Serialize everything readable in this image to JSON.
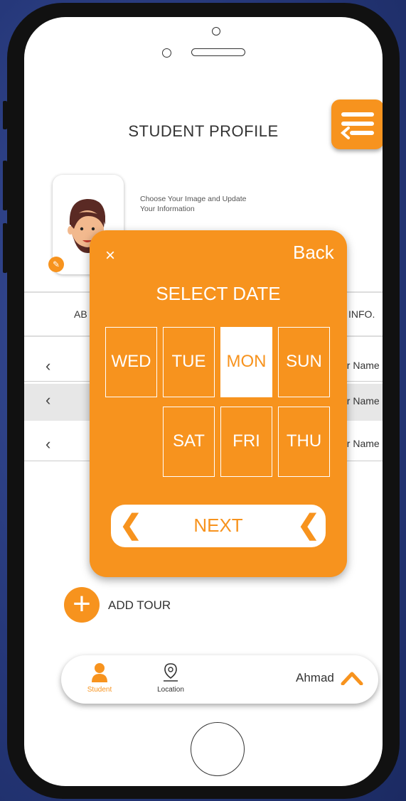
{
  "header": {
    "title": "STUDENT PROFILE"
  },
  "profile": {
    "info_line1": "Choose Your Image and Update",
    "info_line2": "Your Information"
  },
  "tabs": {
    "left_partial": "AB",
    "right_partial": "INFO."
  },
  "rows": [
    {
      "value": "ur Name"
    },
    {
      "value": "ur Name"
    },
    {
      "value": "ur Name"
    }
  ],
  "modal": {
    "close": "×",
    "back": "Back",
    "title": "SELECT DATE",
    "days_row1": [
      "WED",
      "TUE",
      "MON",
      "SUN"
    ],
    "days_row2": [
      "SAT",
      "FRI",
      "THU"
    ],
    "selected_day": "MON",
    "next_label": "NEXT"
  },
  "add_tour": {
    "label": "ADD TOUR"
  },
  "bottom_nav": {
    "student_label": "Student",
    "location_label": "Location",
    "user_name": "Ahmad"
  },
  "colors": {
    "accent": "#f7931e",
    "background": "#26387a"
  },
  "icons": [
    "menu-icon",
    "avatar-face",
    "edit-icon",
    "close-icon",
    "chevron-left-icon",
    "plus-icon",
    "person-icon",
    "location-pin-icon",
    "chevron-up-icon"
  ]
}
